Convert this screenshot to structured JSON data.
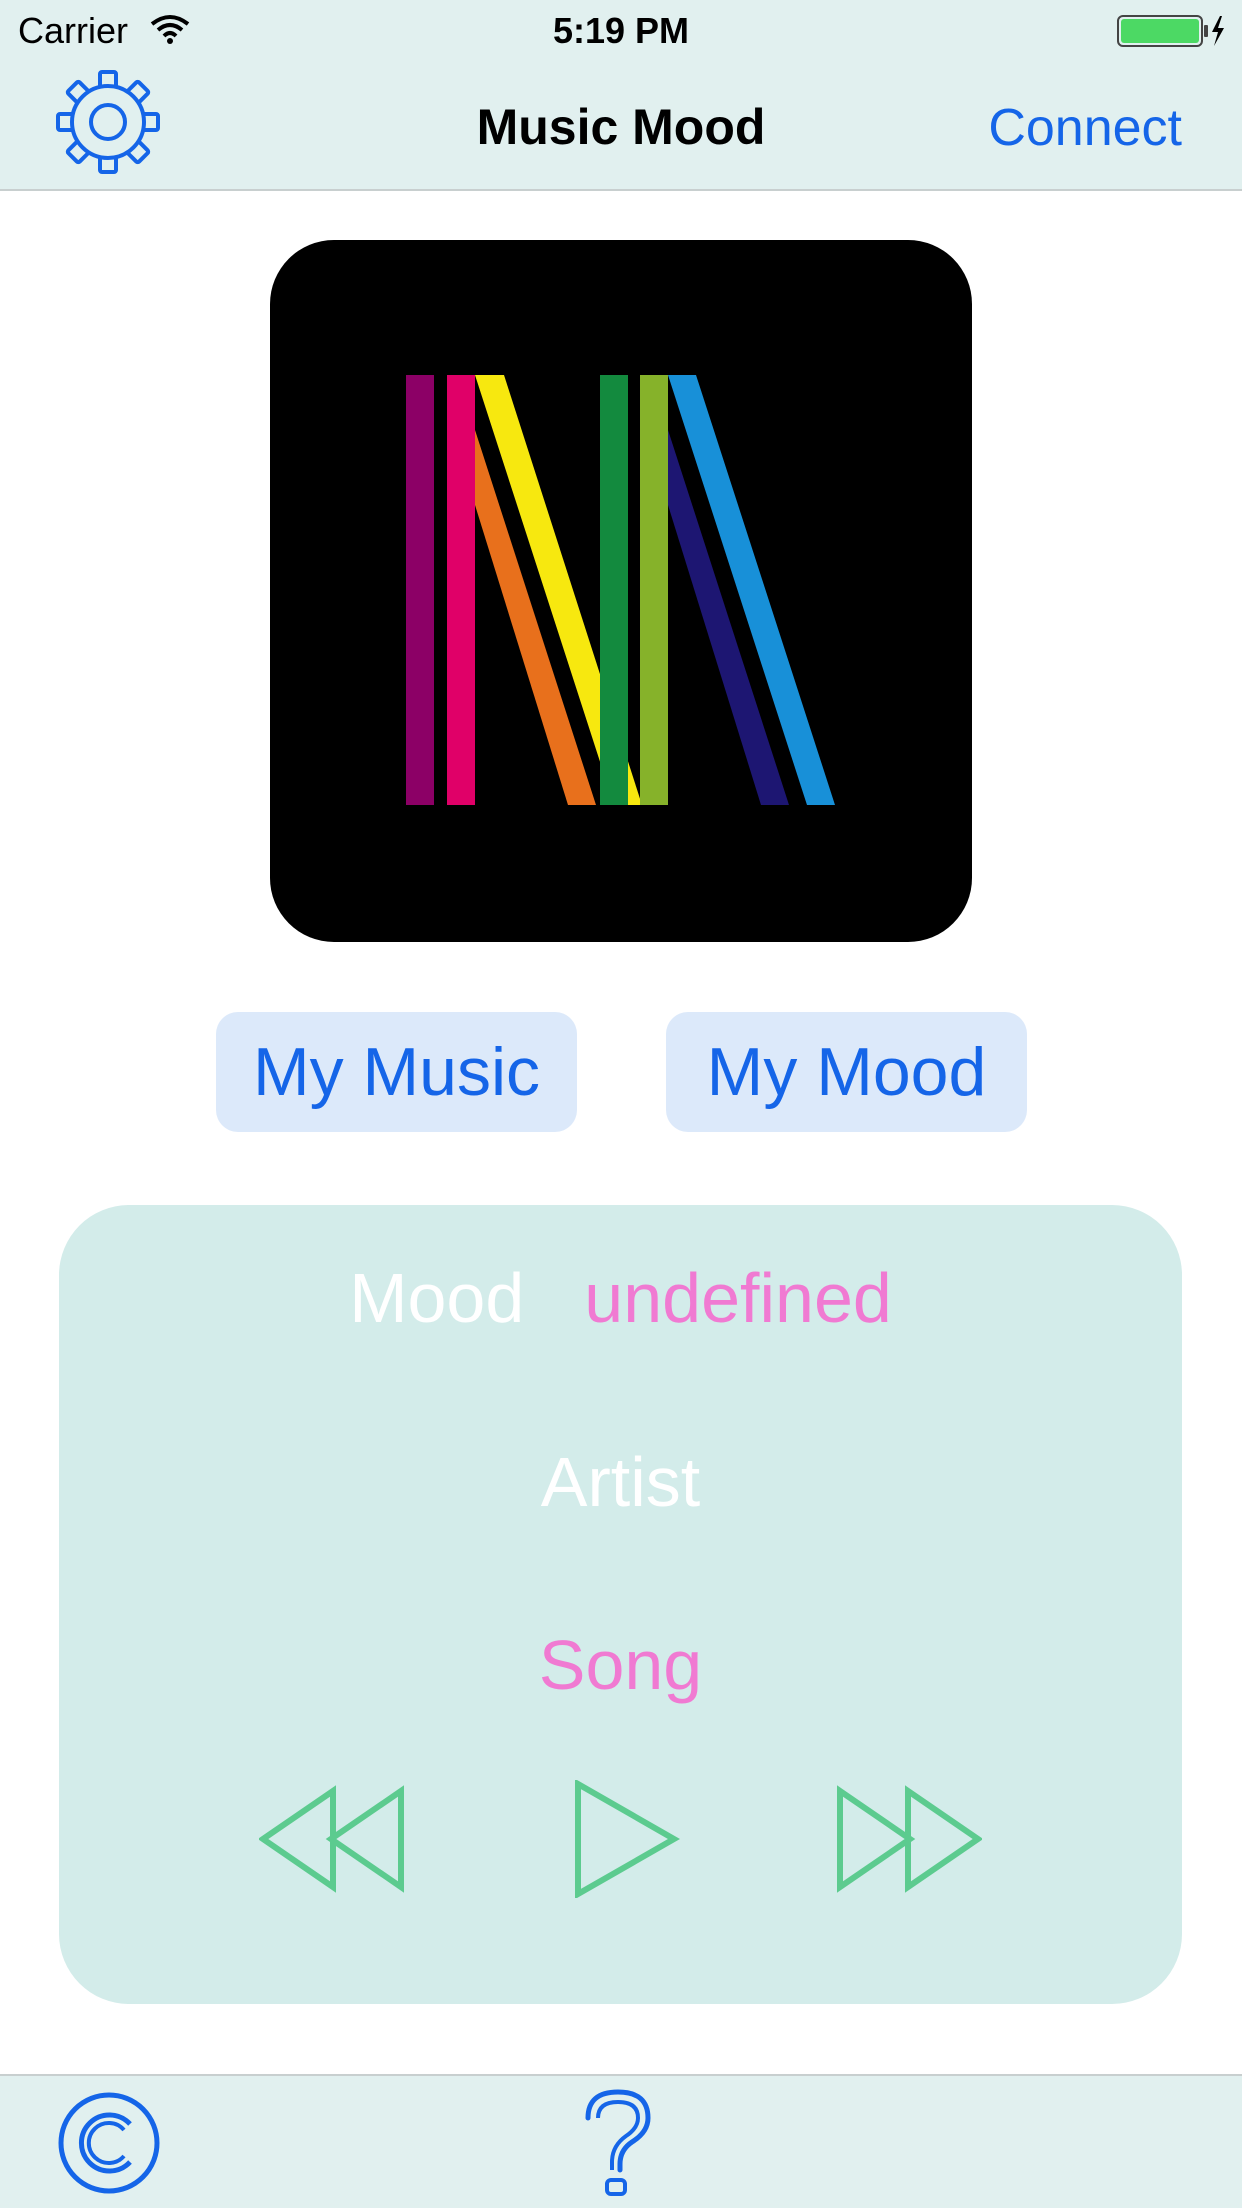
{
  "status_bar": {
    "carrier": "Carrier",
    "time": "5:19 PM"
  },
  "nav": {
    "title": "Music Mood",
    "connect_label": "Connect"
  },
  "buttons": {
    "my_music": "My Music",
    "my_mood": "My Mood"
  },
  "now_playing": {
    "mood_label": "Mood",
    "mood_value": "undefined",
    "artist": "Artist",
    "song": "Song"
  },
  "icons": {
    "settings": "gear-icon",
    "rewind": "rewind-icon",
    "play": "play-icon",
    "fast_forward": "fast-forward-icon",
    "copyright": "copyright-icon",
    "help": "question-mark-icon"
  },
  "colors": {
    "accent": "#1565e8",
    "bar_background": "#e1f0ef",
    "panel_background": "#d3ecea",
    "highlight_pink": "#f07ad2",
    "control_green": "#5ccb8f",
    "pill_background": "#dce9fa"
  }
}
